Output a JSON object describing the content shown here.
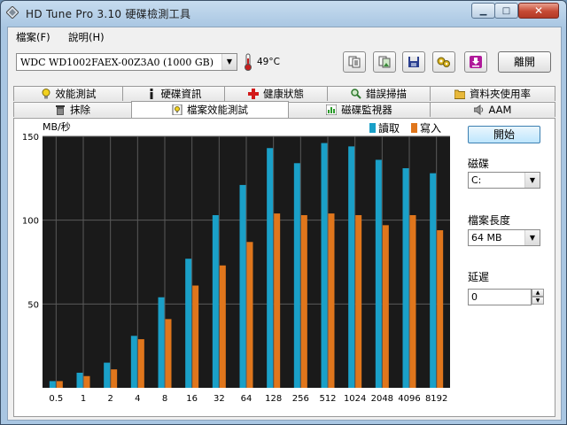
{
  "window": {
    "title": "HD Tune Pro 3.10   硬碟檢測工具"
  },
  "titlebar": {
    "min_glyph": "▁",
    "max_glyph": "□",
    "close_glyph": "✕"
  },
  "menu": [
    {
      "label": "檔案(F)"
    },
    {
      "label": "說明(H)"
    }
  ],
  "toolbar": {
    "drive": "WDC WD1002FAEX-00Z3A0 (1000 GB)",
    "temperature": "49°C",
    "buttons": [
      "copy-text-icon",
      "copy-image-icon",
      "save-icon",
      "options-icon",
      "download-icon"
    ],
    "exit_label": "離開"
  },
  "tabs_top": [
    {
      "label": "效能測試",
      "icon": "lightbulb-icon"
    },
    {
      "label": "硬碟資訊",
      "icon": "info-icon"
    },
    {
      "label": "健康狀態",
      "icon": "health-cross-icon"
    },
    {
      "label": "錯誤掃描",
      "icon": "magnifier-icon"
    },
    {
      "label": "資料夾使用率",
      "icon": "folder-icon"
    }
  ],
  "tabs_bottom": [
    {
      "label": "抹除",
      "icon": "trash-icon"
    },
    {
      "label": "檔案效能測試",
      "icon": "file-benchmark-icon",
      "active": true
    },
    {
      "label": "磁碟監視器",
      "icon": "monitor-icon"
    },
    {
      "label": "AAM",
      "icon": "speaker-icon"
    }
  ],
  "side": {
    "start_label": "開始",
    "drive_label": "磁碟",
    "drive_value": "C:",
    "filesize_label": "檔案長度",
    "filesize_value": "64 MB",
    "delay_label": "延遲",
    "delay_value": "0"
  },
  "colors": {
    "read": "#1aa0c8",
    "write": "#e0761c",
    "plot_bg": "#1a1a1a",
    "grid": "#5a5a5a"
  },
  "chart_data": {
    "type": "bar",
    "ylabel": "MB/秒",
    "ylim": [
      0,
      150
    ],
    "yticks": [
      50,
      100,
      150
    ],
    "grid": true,
    "legend": "top-right",
    "categories": [
      "0.5",
      "1",
      "2",
      "4",
      "8",
      "16",
      "32",
      "64",
      "128",
      "256",
      "512",
      "1024",
      "2048",
      "4096",
      "8192"
    ],
    "series": [
      {
        "name": "讀取",
        "values": [
          4,
          9,
          15,
          31,
          54,
          77,
          103,
          121,
          143,
          134,
          146,
          144,
          136,
          131,
          128
        ]
      },
      {
        "name": "寫入",
        "values": [
          4,
          7,
          11,
          29,
          41,
          61,
          73,
          87,
          104,
          103,
          104,
          103,
          97,
          103,
          94
        ]
      }
    ]
  }
}
